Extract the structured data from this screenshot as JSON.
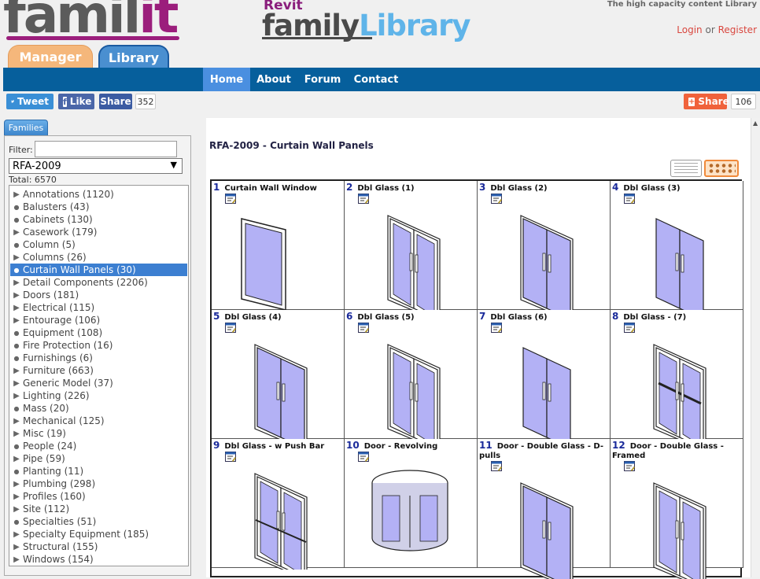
{
  "header": {
    "logo_primary": "famil",
    "logo_accent": "it",
    "tab_manager": "Manager",
    "tab_library": "Library",
    "revit_word": "Revit",
    "logo_family": "family",
    "logo_library": "Library",
    "tagline": "The high capacity content Library",
    "login": "Login",
    "or": "or",
    "register": "Register"
  },
  "nav": {
    "items": [
      "Home",
      "About",
      "Forum",
      "Contact"
    ],
    "active": "Home"
  },
  "social": {
    "tweet": "Tweet",
    "like": "Like",
    "share_left": "Share",
    "share_left_count": "352",
    "share_right": "Share",
    "share_right_count": "106"
  },
  "sidebar": {
    "tab": "Families",
    "filter_label": "Filter:",
    "filter_value": "",
    "select_value": "RFA-2009",
    "total_label": "Total: 6570",
    "items": [
      {
        "label": "Annotations (1120)",
        "type": "arrow"
      },
      {
        "label": "Balusters (43)",
        "type": "dot"
      },
      {
        "label": "Cabinets (130)",
        "type": "dot"
      },
      {
        "label": "Casework (179)",
        "type": "arrow"
      },
      {
        "label": "Column (5)",
        "type": "dot"
      },
      {
        "label": "Columns (26)",
        "type": "arrow"
      },
      {
        "label": "Curtain Wall Panels (30)",
        "type": "dot",
        "selected": true
      },
      {
        "label": "Detail Components (2206)",
        "type": "arrow"
      },
      {
        "label": "Doors (181)",
        "type": "arrow"
      },
      {
        "label": "Electrical (115)",
        "type": "arrow"
      },
      {
        "label": "Entourage (106)",
        "type": "arrow"
      },
      {
        "label": "Equipment (108)",
        "type": "dot"
      },
      {
        "label": "Fire Protection (16)",
        "type": "dot"
      },
      {
        "label": "Furnishings (6)",
        "type": "dot"
      },
      {
        "label": "Furniture (663)",
        "type": "arrow"
      },
      {
        "label": "Generic Model (37)",
        "type": "arrow"
      },
      {
        "label": "Lighting (226)",
        "type": "arrow"
      },
      {
        "label": "Mass (20)",
        "type": "dot"
      },
      {
        "label": "Mechanical (125)",
        "type": "arrow"
      },
      {
        "label": "Misc (19)",
        "type": "arrow"
      },
      {
        "label": "People (24)",
        "type": "dot"
      },
      {
        "label": "Pipe (59)",
        "type": "arrow"
      },
      {
        "label": "Planting (11)",
        "type": "dot"
      },
      {
        "label": "Plumbing (298)",
        "type": "arrow"
      },
      {
        "label": "Profiles (160)",
        "type": "arrow"
      },
      {
        "label": "Site (112)",
        "type": "arrow"
      },
      {
        "label": "Specialties (51)",
        "type": "dot"
      },
      {
        "label": "Specialty Equipment (185)",
        "type": "arrow"
      },
      {
        "label": "Structural (155)",
        "type": "arrow"
      },
      {
        "label": "Windows (154)",
        "type": "arrow"
      }
    ]
  },
  "main": {
    "heading": "RFA-2009 - Curtain Wall Panels",
    "families": [
      {
        "num": "1",
        "name": "Curtain Wall Window",
        "shape": "window"
      },
      {
        "num": "2",
        "name": "Dbl Glass (1)",
        "shape": "double"
      },
      {
        "num": "3",
        "name": "Dbl Glass (2)",
        "shape": "double-thin"
      },
      {
        "num": "4",
        "name": "Dbl Glass (3)",
        "shape": "double-frameless"
      },
      {
        "num": "5",
        "name": "Dbl Glass (4)",
        "shape": "double-thin"
      },
      {
        "num": "6",
        "name": "Dbl Glass (5)",
        "shape": "double"
      },
      {
        "num": "7",
        "name": "Dbl Glass (6)",
        "shape": "double-frameless"
      },
      {
        "num": "8",
        "name": "Dbl Glass - (7)",
        "shape": "double-mullion"
      },
      {
        "num": "9",
        "name": "Dbl Glass - w Push Bar",
        "shape": "pushbar"
      },
      {
        "num": "10",
        "name": "Door - Revolving",
        "shape": "revolving"
      },
      {
        "num": "11",
        "name": "Door - Double Glass - D-pulls",
        "shape": "double-thin"
      },
      {
        "num": "12",
        "name": "Door - Double Glass - Framed",
        "shape": "double"
      }
    ]
  }
}
